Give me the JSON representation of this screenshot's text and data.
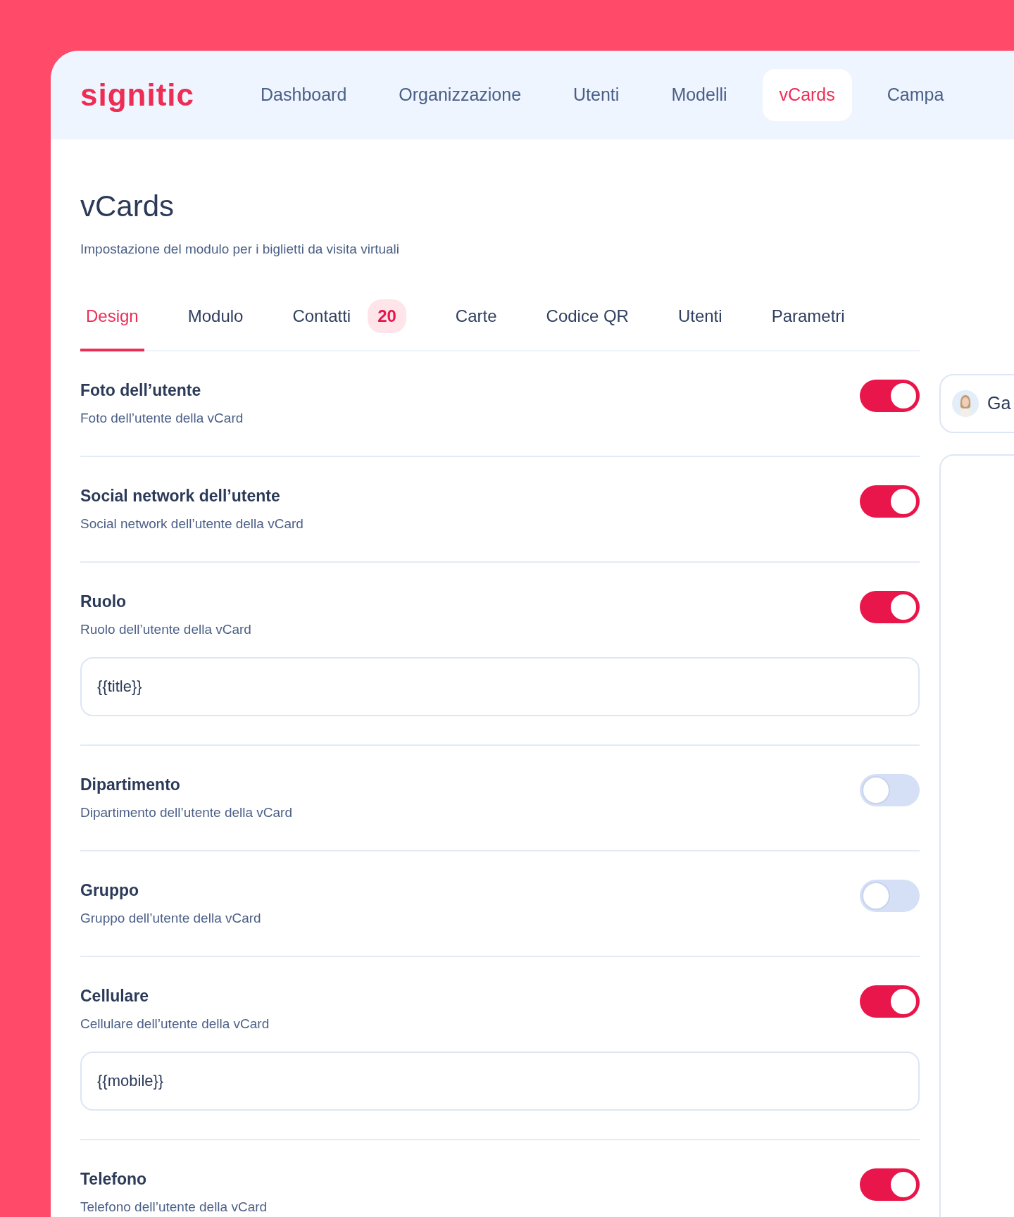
{
  "brand": "signitic",
  "nav": [
    {
      "label": "Dashboard",
      "selected": false
    },
    {
      "label": "Organizzazione",
      "selected": false
    },
    {
      "label": "Utenti",
      "selected": false
    },
    {
      "label": "Modelli",
      "selected": false
    },
    {
      "label": "vCards",
      "selected": true
    },
    {
      "label": "Campa",
      "selected": false
    }
  ],
  "page": {
    "title": "vCards",
    "subtitle": "Impostazione del modulo per i biglietti da visita virtuali"
  },
  "tabs": [
    {
      "label": "Design",
      "selected": true
    },
    {
      "label": "Modulo",
      "selected": false
    },
    {
      "label": "Contatti",
      "badge": "20",
      "selected": false
    },
    {
      "label": "Carte",
      "selected": false
    },
    {
      "label": "Codice QR",
      "selected": false
    },
    {
      "label": "Utenti",
      "selected": false
    },
    {
      "label": "Parametri",
      "selected": false
    }
  ],
  "settings": [
    {
      "title": "Foto dell’utente",
      "description": "Foto dell’utente della vCard",
      "on": true
    },
    {
      "title": "Social network dell’utente",
      "description": "Social network dell’utente della vCard",
      "on": true
    },
    {
      "title": "Ruolo",
      "description": "Ruolo dell’utente della vCard",
      "on": true,
      "value": "{{title}}"
    },
    {
      "title": "Dipartimento",
      "description": "Dipartimento dell’utente della vCard",
      "on": false
    },
    {
      "title": "Gruppo",
      "description": "Gruppo dell’utente della vCard",
      "on": false
    },
    {
      "title": "Cellulare",
      "description": "Cellulare dell’utente della vCard",
      "on": true,
      "value": "{{mobile}}"
    },
    {
      "title": "Telefono",
      "description": "Telefono dell’utente della vCard",
      "on": true
    }
  ],
  "preview": {
    "user_name": "Ga"
  }
}
